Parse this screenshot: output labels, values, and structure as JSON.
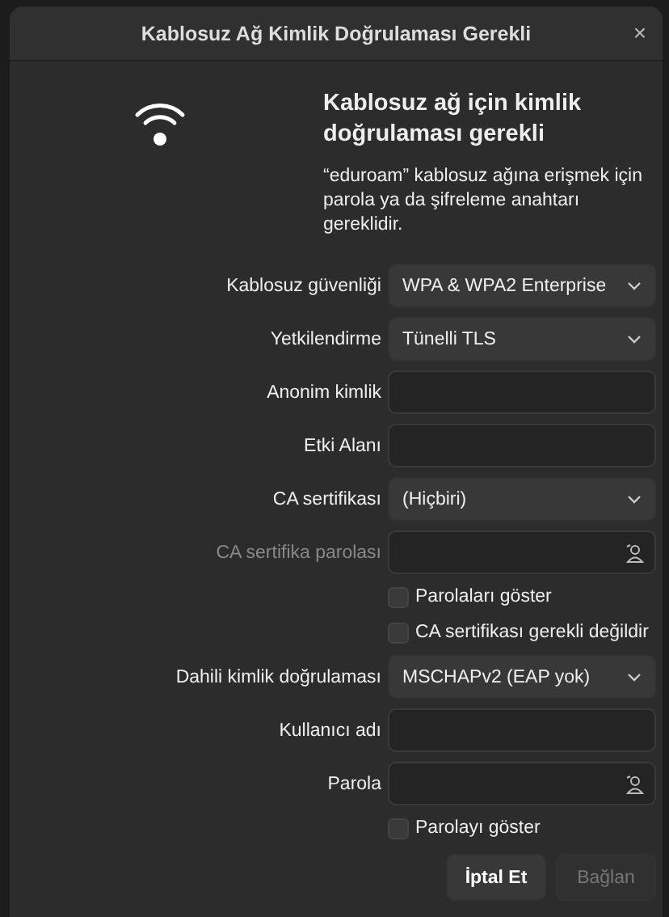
{
  "window": {
    "title": "Kablosuz Ağ Kimlik Doğrulaması Gerekli",
    "close": "×"
  },
  "header": {
    "heading": "Kablosuz ağ için kimlik doğrulaması gerekli",
    "message": "“eduroam” kablosuz ağına erişmek için parola ya da şifreleme anahtarı gereklidir."
  },
  "fields": [
    {
      "kind": "combo",
      "label": "Kablosuz güvenliği",
      "value": "WPA & WPA2 Enterprise",
      "disabled": false
    },
    {
      "kind": "combo",
      "label": "Yetkilendirme",
      "value": "Tünelli TLS",
      "disabled": false
    },
    {
      "kind": "entry",
      "label": "Anonim kimlik",
      "disabled": false
    },
    {
      "kind": "entry",
      "label": "Etki Alanı",
      "disabled": false
    },
    {
      "kind": "combo",
      "label": "CA sertifikası",
      "value": "(Hiçbiri)",
      "disabled": false
    },
    {
      "kind": "password",
      "label": "CA sertifika parolası",
      "disabled": true
    },
    {
      "kind": "check",
      "label": "Parolaları göster",
      "checked": false
    },
    {
      "kind": "check",
      "label": "CA sertifikası gerekli değildir",
      "checked": false
    },
    {
      "kind": "combo",
      "label": "Dahili kimlik doğrulaması",
      "value": "MSCHAPv2 (EAP yok)",
      "disabled": false
    },
    {
      "kind": "entry",
      "label": "Kullanıcı adı",
      "disabled": false
    },
    {
      "kind": "password",
      "label": "Parola",
      "disabled": false
    },
    {
      "kind": "check",
      "label": "Parolayı göster",
      "checked": false
    }
  ],
  "buttons": [
    {
      "label": "İptal Et",
      "disabled": false
    },
    {
      "label": "Bağlan",
      "disabled": true
    }
  ]
}
